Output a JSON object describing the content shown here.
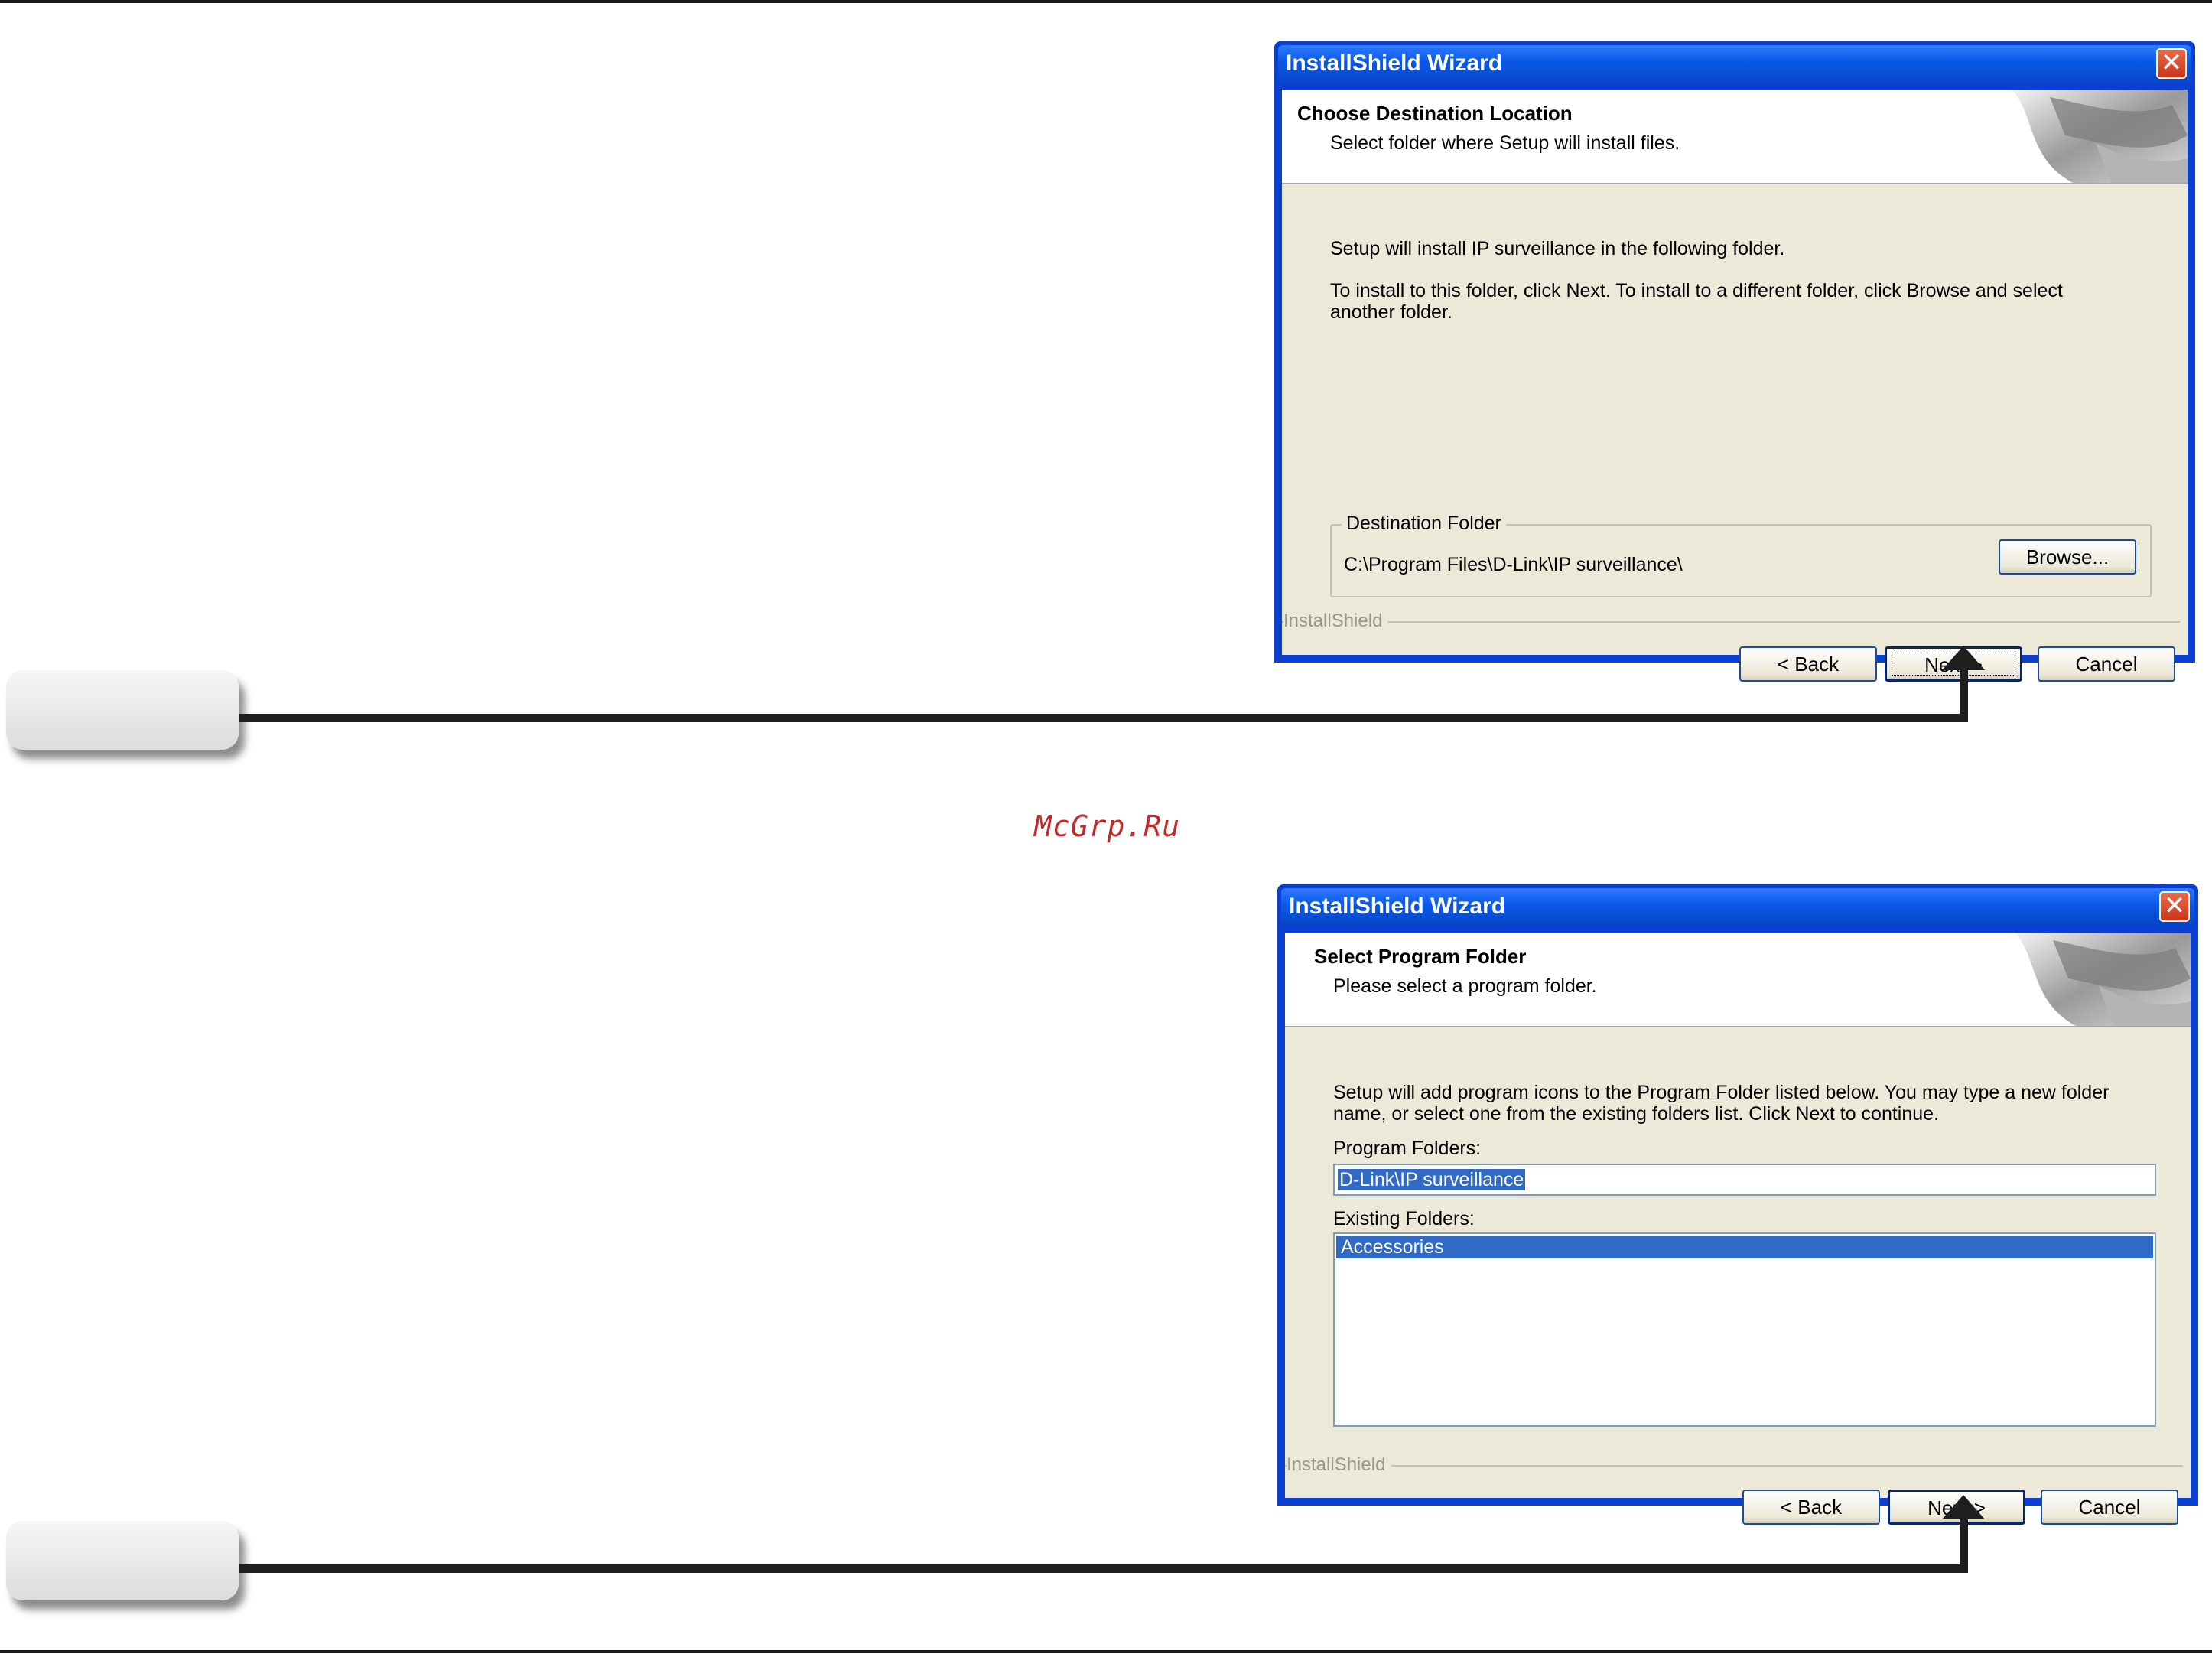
{
  "watermark": "McGrp.Ru",
  "dialog1": {
    "title": "InstallShield Wizard",
    "heading": "Choose Destination Location",
    "subheading": "Select folder where Setup will install files.",
    "line1": "Setup will install IP surveillance in the following folder.",
    "line2a": "To install to this folder, click Next. To install to a different folder, click Browse and select",
    "line2b": "another folder.",
    "group_label": "Destination Folder",
    "path": "C:\\Program Files\\D-Link\\IP surveillance\\",
    "browse_label": "Browse...",
    "brand": "InstallShield",
    "back_label": "< Back",
    "next_label": "Next >",
    "cancel_label": "Cancel"
  },
  "dialog2": {
    "title": "InstallShield Wizard",
    "heading": "Select Program Folder",
    "subheading": "Please select a program folder.",
    "line1a": "Setup will add program icons to the Program Folder listed below.  You may type a new folder",
    "line1b": "name, or select one from the existing folders list.  Click Next to continue.",
    "program_folders_label": "Program Folders:",
    "program_folder_value": "D-Link\\IP surveillance",
    "existing_folders_label": "Existing Folders:",
    "existing_folders": [
      "Accessories"
    ],
    "brand": "InstallShield",
    "back_label": "< Back",
    "next_label": "Next >",
    "cancel_label": "Cancel"
  }
}
